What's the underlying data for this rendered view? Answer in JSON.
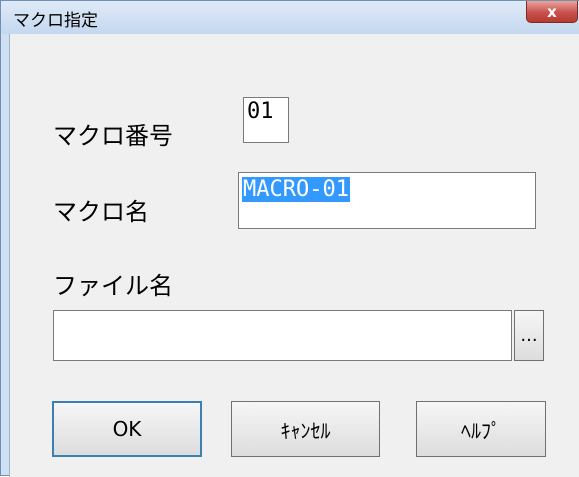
{
  "window": {
    "title": "マクロ指定",
    "close_label": "x"
  },
  "form": {
    "macro_number_label": "マクロ番号",
    "macro_number_value": "01",
    "macro_name_label": "マクロ名",
    "macro_name_value": "MACRO-01",
    "file_name_label": "ファイル名",
    "file_name_value": "",
    "browse_label": "..."
  },
  "buttons": {
    "ok": "OK",
    "cancel": "ｷｬﾝｾﾙ",
    "help": "ﾍﾙﾌﾟ"
  }
}
